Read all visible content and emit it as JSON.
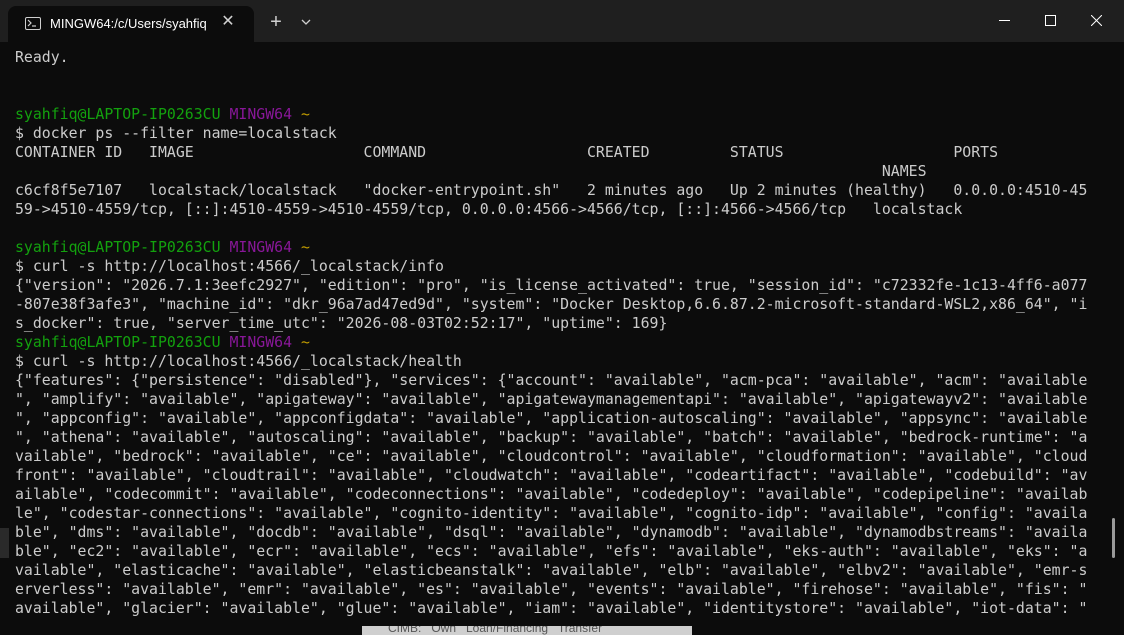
{
  "window": {
    "tab_title": "MINGW64:/c/Users/syahfiq",
    "tab_close_glyph": "✕",
    "new_tab_glyph": "+",
    "icons": [
      "terminal-icon",
      "chevron-down-icon",
      "minimize-icon",
      "maximize-icon",
      "close-icon"
    ]
  },
  "colors": {
    "user_host": "#13a10e",
    "shell": "#881798",
    "path": "#c19c00",
    "text": "#cccccc",
    "background": "#0c0c0c"
  },
  "terminal": {
    "ready": "Ready.",
    "prompts": [
      {
        "user_host": "syahfiq@LAPTOP-IP0263CU",
        "shell": "MINGW64",
        "path": "~",
        "command": "$ docker ps --filter name=localstack"
      },
      {
        "user_host": "syahfiq@LAPTOP-IP0263CU",
        "shell": "MINGW64",
        "path": "~",
        "command": "$ curl -s http://localhost:4566/_localstack/info"
      },
      {
        "user_host": "syahfiq@LAPTOP-IP0263CU",
        "shell": "MINGW64",
        "path": "~",
        "command": "$ curl -s http://localhost:4566/_localstack/health"
      }
    ],
    "docker_output": [
      "CONTAINER ID   IMAGE                   COMMAND                  CREATED         STATUS                   PORTS",
      "                                                                                                 NAMES",
      "c6cf8f5e7107   localstack/localstack   \"docker-entrypoint.sh\"   2 minutes ago   Up 2 minutes (healthy)   0.0.0.0:4510-45",
      "59->4510-4559/tcp, [::]:4510-4559->4510-4559/tcp, 0.0.0.0:4566->4566/tcp, [::]:4566->4566/tcp   localstack"
    ],
    "info_output": [
      "{\"version\": \"2026.7.1:3eefc2927\", \"edition\": \"pro\", \"is_license_activated\": true, \"session_id\": \"c72332fe-1c13-4ff6-a077",
      "-807e38f3afe3\", \"machine_id\": \"dkr_96a7ad47ed9d\", \"system\": \"Docker Desktop,6.6.87.2-microsoft-standard-WSL2,x86_64\", \"i",
      "s_docker\": true, \"server_time_utc\": \"2026-08-03T02:52:17\", \"uptime\": 169}"
    ],
    "health_output": [
      "{\"features\": {\"persistence\": \"disabled\"}, \"services\": {\"account\": \"available\", \"acm-pca\": \"available\", \"acm\": \"available",
      "\", \"amplify\": \"available\", \"apigateway\": \"available\", \"apigatewaymanagementapi\": \"available\", \"apigatewayv2\": \"available",
      "\", \"appconfig\": \"available\", \"appconfigdata\": \"available\", \"application-autoscaling\": \"available\", \"appsync\": \"available",
      "\", \"athena\": \"available\", \"autoscaling\": \"available\", \"backup\": \"available\", \"batch\": \"available\", \"bedrock-runtime\": \"a",
      "vailable\", \"bedrock\": \"available\", \"ce\": \"available\", \"cloudcontrol\": \"available\", \"cloudformation\": \"available\", \"cloud",
      "front\": \"available\", \"cloudtrail\": \"available\", \"cloudwatch\": \"available\", \"codeartifact\": \"available\", \"codebuild\": \"av",
      "ailable\", \"codecommit\": \"available\", \"codeconnections\": \"available\", \"codedeploy\": \"available\", \"codepipeline\": \"availab",
      "le\", \"codestar-connections\": \"available\", \"cognito-identity\": \"available\", \"cognito-idp\": \"available\", \"config\": \"availa",
      "ble\", \"dms\": \"available\", \"docdb\": \"available\", \"dsql\": \"available\", \"dynamodb\": \"available\", \"dynamodbstreams\": \"availa",
      "ble\", \"ec2\": \"available\", \"ecr\": \"available\", \"ecs\": \"available\", \"efs\": \"available\", \"eks-auth\": \"available\", \"eks\": \"a",
      "vailable\", \"elasticache\": \"available\", \"elasticbeanstalk\": \"available\", \"elb\": \"available\", \"elbv2\": \"available\", \"emr-s",
      "erverless\": \"available\", \"emr\": \"available\", \"es\": \"available\", \"events\": \"available\", \"firehose\": \"available\", \"fis\": \"",
      "available\", \"glacier\": \"available\", \"glue\": \"available\", \"iam\": \"available\", \"identitystore\": \"available\", \"iot-data\": \""
    ]
  },
  "background_window": {
    "text": "CIMB:   Own   Loan/Financing   Transfer"
  }
}
